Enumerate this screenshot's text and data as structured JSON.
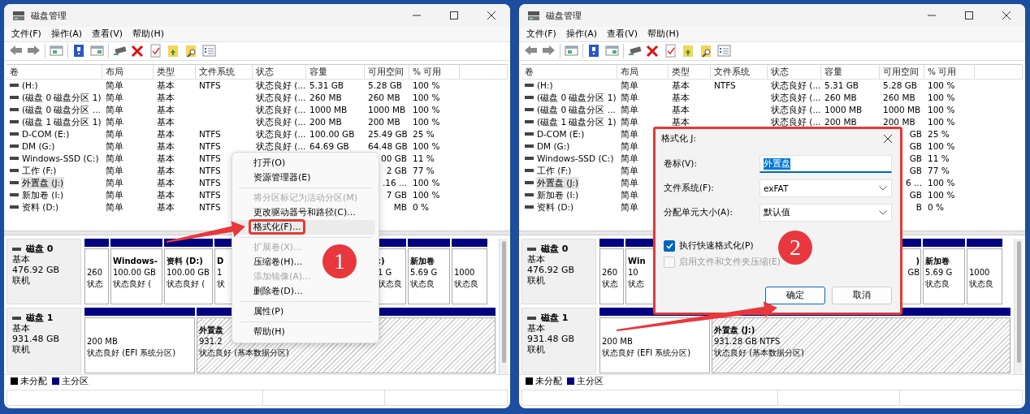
{
  "windows": [
    {
      "title": "磁盘管理",
      "menu": [
        "文件(F)",
        "操作(A)",
        "查看(V)",
        "帮助(H)"
      ],
      "table": {
        "columns": [
          "卷",
          "布局",
          "类型",
          "文件系统",
          "状态",
          "容量",
          "可用空间",
          "% 可用"
        ],
        "rows": [
          {
            "selected": false,
            "cells": [
              "(H:)",
              "简单",
              "基本",
              "NTFS",
              "状态良好 (...",
              "5.31 GB",
              "5.28 GB",
              "100 %"
            ]
          },
          {
            "selected": false,
            "cells": [
              "(磁盘 0 磁盘分区 1)",
              "简单",
              "基本",
              null,
              "状态良好 (...",
              "260 MB",
              "260 MB",
              "100 %"
            ]
          },
          {
            "selected": false,
            "cells": [
              "(磁盘 0 磁盘分区 ...",
              "简单",
              "基本",
              null,
              "状态良好 (...",
              "1000 MB",
              "1000 MB",
              "100 %"
            ]
          },
          {
            "selected": false,
            "cells": [
              "(磁盘 1 磁盘分区 1)",
              "简单",
              "基本",
              null,
              "状态良好 (...",
              "200 MB",
              "200 MB",
              "100 %"
            ]
          },
          {
            "selected": false,
            "cells": [
              "D-COM (E:)",
              "简单",
              "基本",
              "NTFS",
              "状态良好 (...",
              "100.00 GB",
              "25.49 GB",
              "25 %"
            ]
          },
          {
            "selected": false,
            "cells": [
              "DM (G:)",
              "简单",
              "基本",
              "NTFS",
              "状态良好 (...",
              "64.69 GB",
              "64.48 GB",
              "100 %"
            ]
          },
          {
            "selected": false,
            "cells": [
              "Windows-SSD (C:)",
              "简单",
              "基本",
              "NTFS",
              null,
              null,
              {
                "text": "00 GB",
                "covered": true
              },
              "11 %"
            ]
          },
          {
            "selected": false,
            "cells": [
              "工作 (F:)",
              "简单",
              "基本",
              "NTFS",
              null,
              null,
              {
                "text": "2 GB",
                "covered": true
              },
              "77 %"
            ]
          },
          {
            "selected": true,
            "cells": [
              "外置盘 (J:)",
              "简单",
              "基本",
              "NTFS",
              null,
              null,
              {
                "text": ".16 ...",
                "covered": true
              },
              "100 %"
            ]
          },
          {
            "selected": false,
            "cells": [
              "新加卷 (I:)",
              "简单",
              "基本",
              "NTFS",
              null,
              null,
              {
                "text": "7 GB",
                "covered": true
              },
              "100 %"
            ]
          },
          {
            "selected": false,
            "cells": [
              "资料 (D:)",
              "简单",
              "基本",
              "NTFS",
              null,
              null,
              {
                "text": "MB",
                "covered": true
              },
              "0 %"
            ]
          }
        ]
      },
      "disks": [
        {
          "name": "磁盘 0",
          "info": [
            "基本",
            "476.92 GB",
            "联机"
          ],
          "partitions": [
            {
              "selected": false,
              "lines": [
                "260",
                "状态"
              ]
            },
            {
              "selected": false,
              "title": "Windows-",
              "lines": [
                "100.00 GB",
                "状态良好 ("
              ]
            },
            {
              "selected": false,
              "title": "资料 (D:)",
              "lines": [
                "100.00 GB",
                "状态良好 ("
              ]
            },
            {
              "selected": false,
              "title": "D",
              "lines": [
                "1",
                "状"
              ]
            },
            {
              "selected": false,
              "title": ":)",
              "lines": [
                "1 G",
                "状态良"
              ]
            },
            {
              "selected": false,
              "title": "新加卷",
              "lines": [
                "5.69 G",
                "状态良"
              ]
            },
            {
              "selected": false,
              "lines": [
                "1000",
                "状态良"
              ]
            }
          ]
        },
        {
          "name": "磁盘 1",
          "info": [
            "基本",
            "931.48 GB",
            "联机"
          ],
          "partitions": [
            {
              "selected": false,
              "lines": [
                "200 MB",
                "状态良好 (EFI 系统分区)"
              ]
            },
            {
              "selected": true,
              "title": "外置盘",
              "lines": [
                "931.2",
                "状态良好 (基本数据分区)"
              ]
            }
          ]
        }
      ],
      "legend": [
        {
          "label": "未分配",
          "color": "#000000"
        },
        {
          "label": "主分区",
          "color": "#000080"
        }
      ],
      "context_menu": {
        "items": [
          {
            "kind": "item",
            "label": "打开(O)",
            "disabled": false,
            "highlighted": false
          },
          {
            "kind": "item",
            "label": "资源管理器(E)",
            "disabled": false,
            "highlighted": false
          },
          {
            "kind": "separator"
          },
          {
            "kind": "item",
            "label": "将分区标记为活动分区(M)",
            "disabled": true,
            "highlighted": false
          },
          {
            "kind": "item",
            "label": "更改驱动器号和路径(C)...",
            "disabled": false,
            "highlighted": false
          },
          {
            "kind": "item",
            "label": "格式化(F)...",
            "disabled": false,
            "highlighted": true
          },
          {
            "kind": "separator"
          },
          {
            "kind": "item",
            "label": "扩展卷(X)...",
            "disabled": true,
            "highlighted": false
          },
          {
            "kind": "item",
            "label": "压缩卷(H)...",
            "disabled": false,
            "highlighted": false
          },
          {
            "kind": "item",
            "label": "添加镜像(A)...",
            "disabled": true,
            "highlighted": false
          },
          {
            "kind": "item",
            "label": "删除卷(D)...",
            "disabled": false,
            "highlighted": false
          },
          {
            "kind": "separator"
          },
          {
            "kind": "item",
            "label": "属性(P)",
            "disabled": false,
            "highlighted": false
          },
          {
            "kind": "separator"
          },
          {
            "kind": "item",
            "label": "帮助(H)",
            "disabled": false,
            "highlighted": false
          }
        ]
      },
      "callout": {
        "badge": "1"
      }
    },
    {
      "title": "磁盘管理",
      "menu": [
        "文件(F)",
        "操作(A)",
        "查看(V)",
        "帮助(H)"
      ],
      "table": {
        "columns": [
          "卷",
          "布局",
          "类型",
          "文件系统",
          "状态",
          "容量",
          "可用空间",
          "% 可用"
        ],
        "rows": [
          {
            "selected": false,
            "cells": [
              "(H:)",
              "简单",
              "基本",
              "NTFS",
              "状态良好 (...",
              "5.31 GB",
              "5.28 GB",
              "100 %"
            ]
          },
          {
            "selected": false,
            "cells": [
              "(磁盘 0 磁盘分区 1)",
              "简单",
              "基本",
              null,
              "状态良好 (...",
              "260 MB",
              "260 MB",
              "100 %"
            ]
          },
          {
            "selected": false,
            "cells": [
              "(磁盘 0 磁盘分区 ...",
              "简单",
              "基本",
              null,
              "状态良好 (...",
              "1000 MB",
              "1000 MB",
              "100 %"
            ]
          },
          {
            "selected": false,
            "cells": [
              "(磁盘 1 磁盘分区 1)",
              "简单",
              "基本",
              null,
              "状态良好 (...",
              "200 MB",
              "200 MB",
              "100 %"
            ]
          },
          {
            "selected": false,
            "cells": [
              "D-COM (E:)",
              "简单",
              null,
              null,
              null,
              null,
              {
                "text": "GB",
                "covered": true
              },
              "25 %"
            ]
          },
          {
            "selected": false,
            "cells": [
              "DM (G:)",
              "简单",
              null,
              null,
              null,
              null,
              {
                "text": "GB",
                "covered": true
              },
              "100 %"
            ]
          },
          {
            "selected": false,
            "cells": [
              "Windows-SSD (C:)",
              "简单",
              null,
              null,
              null,
              null,
              {
                "text": "GB",
                "covered": true
              },
              "11 %"
            ]
          },
          {
            "selected": false,
            "cells": [
              "工作 (F:)",
              "简单",
              null,
              null,
              null,
              null,
              {
                "text": "GB",
                "covered": true
              },
              "77 %"
            ]
          },
          {
            "selected": true,
            "cells": [
              "外置盘 (J:)",
              "简单",
              null,
              null,
              null,
              null,
              {
                "text": "6 ...",
                "covered": true
              },
              "100 %"
            ]
          },
          {
            "selected": false,
            "cells": [
              "新加卷 (I:)",
              "简单",
              null,
              null,
              null,
              null,
              {
                "text": "GB",
                "covered": true
              },
              "100 %"
            ]
          },
          {
            "selected": false,
            "cells": [
              "资料 (D:)",
              "简单",
              null,
              null,
              null,
              null,
              {
                "text": "B",
                "covered": true
              },
              "0 %"
            ]
          }
        ]
      },
      "disks": [
        {
          "name": "磁盘 0",
          "info": [
            "基本",
            "476.92 GB",
            "联机"
          ],
          "partitions": [
            {
              "selected": false,
              "lines": [
                "260",
                "状态"
              ]
            },
            {
              "selected": false,
              "title": "Win",
              "lines": [
                "10",
                "状态"
              ]
            },
            {
              "selected": false,
              "covered": true,
              "title": ")",
              "lines": [
                "GB"
              ]
            },
            {
              "selected": false,
              "title": "新加卷",
              "lines": [
                "5.69 G",
                "状态良"
              ]
            },
            {
              "selected": false,
              "lines": [
                "1000",
                "状态良"
              ]
            }
          ]
        },
        {
          "name": "磁盘 1",
          "info": [
            "基本",
            "931.48 GB",
            "联机"
          ],
          "partitions": [
            {
              "selected": false,
              "lines": [
                "200 MB",
                "状态良好 (EFI 系统分区)"
              ]
            },
            {
              "selected": true,
              "title": "外置盘 (J:)",
              "lines": [
                "931.28 GB NTFS",
                "状态良好 (基本数据分区)"
              ]
            }
          ]
        }
      ],
      "legend": [
        {
          "label": "未分配",
          "color": "#000000"
        },
        {
          "label": "主分区",
          "color": "#000080"
        }
      ],
      "dialog": {
        "title": "格式化 J:",
        "highlighted": true,
        "fields": [
          {
            "kind": "text",
            "label": "卷标(V):",
            "value": "外置盘",
            "selected": true
          },
          {
            "kind": "dropdown",
            "label": "文件系统(F):",
            "value": "exFAT"
          },
          {
            "kind": "dropdown",
            "label": "分配单元大小(A):",
            "value": "默认值"
          }
        ],
        "checkboxes": [
          {
            "label": "执行快速格式化(P)",
            "checked": true,
            "disabled": false
          },
          {
            "label": "启用文件和文件夹压缩(E)",
            "checked": false,
            "disabled": true
          }
        ],
        "buttons": [
          {
            "label": "确定",
            "default": true
          },
          {
            "label": "取消",
            "default": false
          }
        ]
      },
      "callout": {
        "badge": "2"
      }
    }
  ]
}
